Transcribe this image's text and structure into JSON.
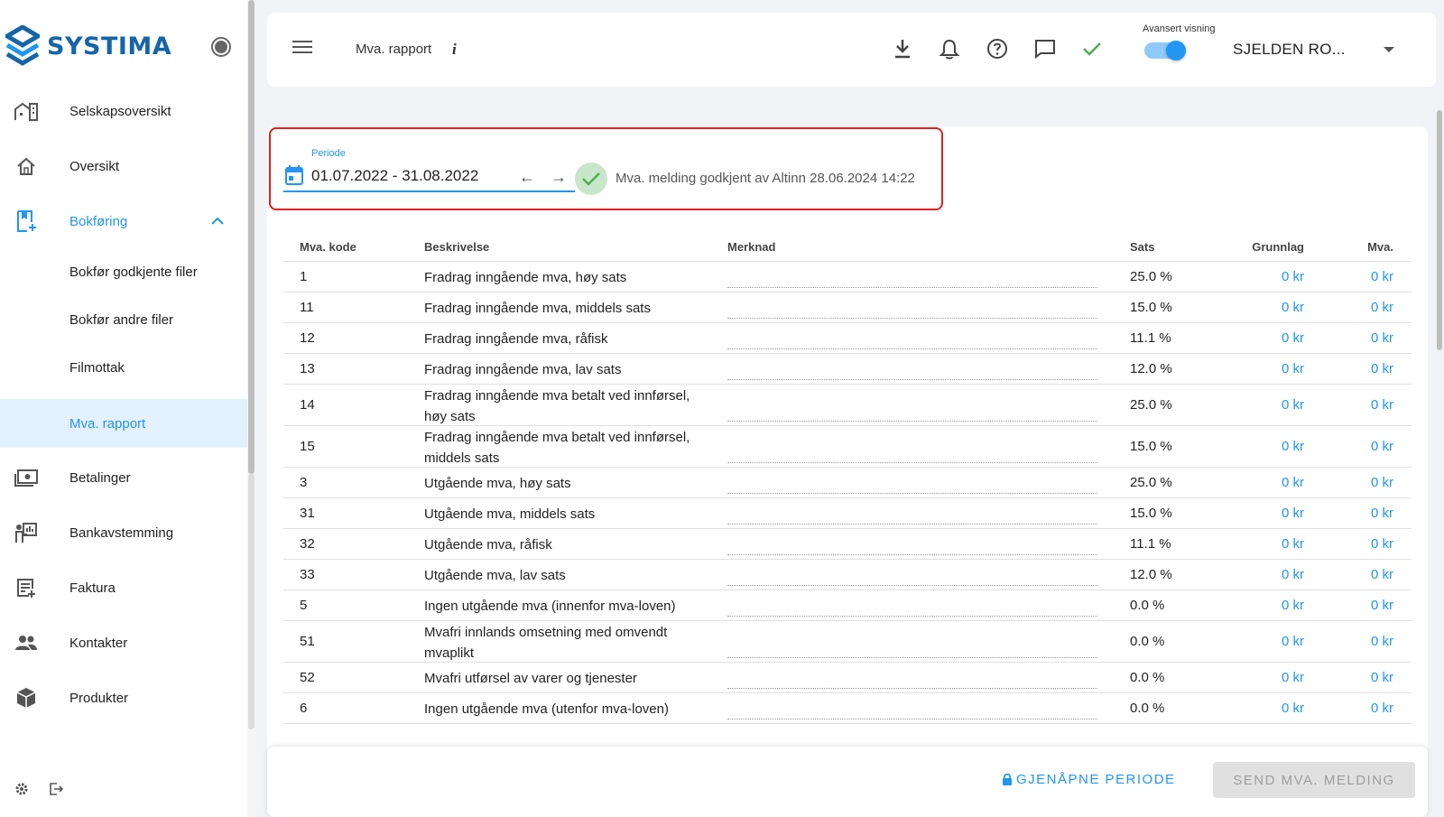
{
  "brand": {
    "name": "SYSTIMA",
    "accent": "#2196f3",
    "logo": "#1565a8"
  },
  "sidebar": {
    "items": [
      {
        "label": "Selskapsoversikt",
        "icon": "company-overview-icon"
      },
      {
        "label": "Oversikt",
        "icon": "home-icon"
      },
      {
        "label": "Bokføring",
        "icon": "bookkeeping-icon"
      },
      {
        "label": "Bokfør godkjente filer"
      },
      {
        "label": "Bokfør andre filer"
      },
      {
        "label": "Filmottak"
      },
      {
        "label": "Mva. rapport"
      },
      {
        "label": "Betalinger",
        "icon": "payments-icon"
      },
      {
        "label": "Bankavstemming",
        "icon": "bank-reconciliation-icon"
      },
      {
        "label": "Faktura",
        "icon": "invoice-icon"
      },
      {
        "label": "Kontakter",
        "icon": "contacts-icon"
      },
      {
        "label": "Produkter",
        "icon": "products-icon"
      }
    ]
  },
  "header": {
    "title": "Mva. rapport",
    "info": "i",
    "advanced_label": "Avansert visning",
    "advanced_on": true,
    "company": "SJELDEN RO..."
  },
  "period": {
    "label": "Periode",
    "value": "01.07.2022 - 31.08.2022",
    "prev": "←",
    "next": "→",
    "status": "Mva. melding godkjent av Altinn 28.06.2024 14:22"
  },
  "table": {
    "headers": {
      "code": "Mva. kode",
      "desc": "Beskrivelse",
      "note": "Merknad",
      "rate": "Sats",
      "base": "Grunnlag",
      "vat": "Mva."
    },
    "rows": [
      {
        "code": "1",
        "desc": "Fradrag inngående mva, høy sats",
        "rate": "25.0 %",
        "base": "0 kr",
        "vat": "0 kr"
      },
      {
        "code": "11",
        "desc": "Fradrag inngående mva, middels sats",
        "rate": "15.0 %",
        "base": "0 kr",
        "vat": "0 kr"
      },
      {
        "code": "12",
        "desc": "Fradrag inngående mva, råfisk",
        "rate": "11.1 %",
        "base": "0 kr",
        "vat": "0 kr"
      },
      {
        "code": "13",
        "desc": "Fradrag inngående mva, lav sats",
        "rate": "12.0 %",
        "base": "0 kr",
        "vat": "0 kr"
      },
      {
        "code": "14",
        "desc": "Fradrag inngående mva betalt ved innførsel, høy sats",
        "rate": "25.0 %",
        "base": "0 kr",
        "vat": "0 kr"
      },
      {
        "code": "15",
        "desc": "Fradrag inngående mva betalt ved innførsel, middels sats",
        "rate": "15.0 %",
        "base": "0 kr",
        "vat": "0 kr"
      },
      {
        "code": "3",
        "desc": "Utgående mva, høy sats",
        "rate": "25.0 %",
        "base": "0 kr",
        "vat": "0 kr"
      },
      {
        "code": "31",
        "desc": "Utgående mva, middels sats",
        "rate": "15.0 %",
        "base": "0 kr",
        "vat": "0 kr"
      },
      {
        "code": "32",
        "desc": "Utgående mva, råfisk",
        "rate": "11.1 %",
        "base": "0 kr",
        "vat": "0 kr"
      },
      {
        "code": "33",
        "desc": "Utgående mva, lav sats",
        "rate": "12.0 %",
        "base": "0 kr",
        "vat": "0 kr"
      },
      {
        "code": "5",
        "desc": "Ingen utgående mva (innenfor mva-loven)",
        "rate": "0.0 %",
        "base": "0 kr",
        "vat": "0 kr"
      },
      {
        "code": "51",
        "desc": "Mvafri innlands omsetning med omvendt mvaplikt",
        "rate": "0.0 %",
        "base": "0 kr",
        "vat": "0 kr"
      },
      {
        "code": "52",
        "desc": "Mvafri utførsel av varer og tjenester",
        "rate": "0.0 %",
        "base": "0 kr",
        "vat": "0 kr"
      },
      {
        "code": "6",
        "desc": "Ingen utgående mva (utenfor mva-loven)",
        "rate": "0.0 %",
        "base": "0 kr",
        "vat": "0 kr"
      }
    ]
  },
  "footer": {
    "reopen_label": "GJENÅPNE PERIODE",
    "send_label": "SEND MVA. MELDING"
  }
}
